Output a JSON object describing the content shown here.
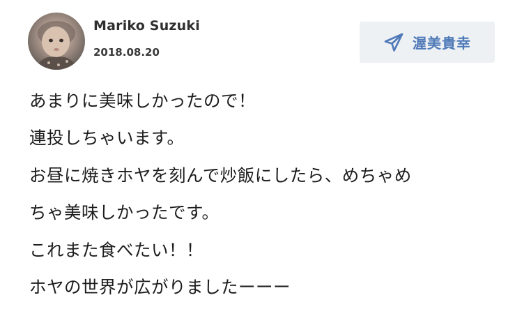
{
  "post": {
    "author_name": "Mariko Suzuki",
    "date": "2018.08.20",
    "send_button_label": "渥美貴幸",
    "send_icon": "paper-plane-icon",
    "accent_color": "#4f7ab8",
    "button_bg_color": "#eef1f4",
    "message_lines": [
      "あまりに美味しかったので！",
      "連投しちゃいます。",
      "お昼に焼きホヤを刻んで炒飯にしたら、めちゃめ",
      "ちゃ美味しかったです。",
      "これまた食べたい！！",
      "ホヤの世界が広がりましたーーー"
    ]
  }
}
